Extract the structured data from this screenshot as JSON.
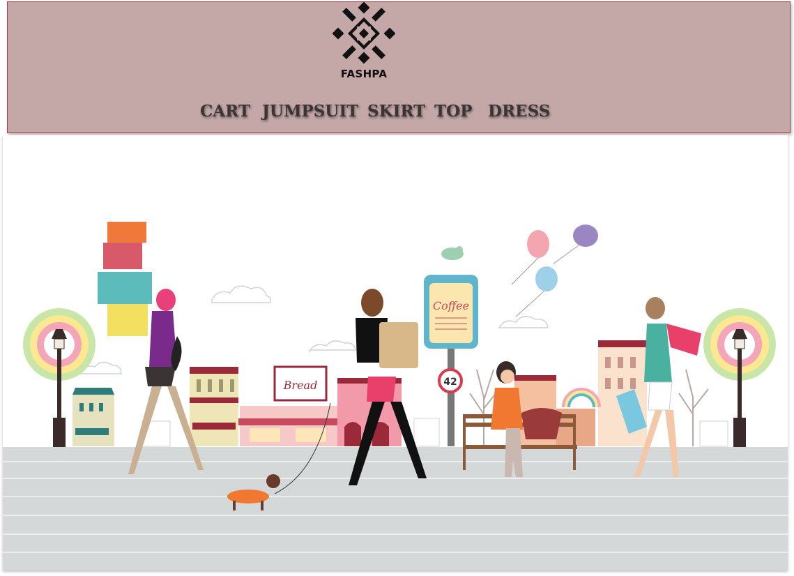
{
  "header": {
    "brand": "FASHPA",
    "logo_icon": "snowflake-logo-icon",
    "background": "#c4a7a7"
  },
  "nav": {
    "items": [
      {
        "label": "CART"
      },
      {
        "label": "JUMPSUIT"
      },
      {
        "label": "SKIRT"
      },
      {
        "label": "TOP"
      },
      {
        "label": "DRESS"
      }
    ]
  },
  "hero": {
    "cafe_sign": "Coffee",
    "bakery_sign": "Bread",
    "speed_sign": "42"
  }
}
